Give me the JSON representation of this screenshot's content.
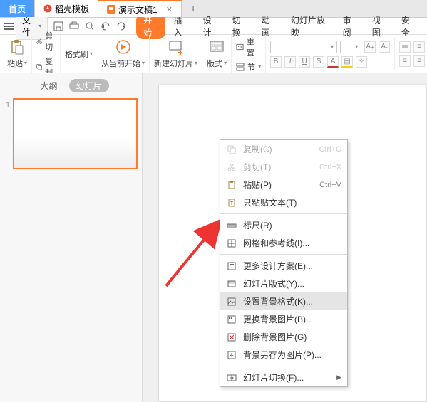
{
  "tabs": {
    "home": "首页",
    "template": "稻壳模板",
    "presentation": "演示文稿1"
  },
  "menubar": {
    "file": "文件",
    "items": [
      "开始",
      "插入",
      "设计",
      "切换",
      "动画",
      "幻灯片放映",
      "审阅",
      "视图",
      "安全"
    ]
  },
  "ribbon": {
    "paste": "粘贴",
    "cut": "剪切",
    "copy": "复制",
    "format_painter": "格式刷",
    "from_begin": "从当前开始",
    "new_slide": "新建幻灯片",
    "layout": "版式",
    "reset": "重置",
    "section": "节",
    "font_name": "",
    "font_size": ""
  },
  "panel": {
    "outline": "大纲",
    "slides": "幻灯片",
    "slide_num": "1"
  },
  "context": {
    "copy": "复制(C)",
    "copy_sc": "Ctrl+C",
    "cut": "剪切(T)",
    "cut_sc": "Ctrl+X",
    "paste": "粘贴(P)",
    "paste_sc": "Ctrl+V",
    "paste_text": "只粘贴文本(T)",
    "ruler": "标尺(R)",
    "grid": "网格和参考线(I)...",
    "more_designs": "更多设计方案(E)...",
    "slide_layout": "幻灯片版式(Y)...",
    "bg_format": "设置背景格式(K)...",
    "change_bg": "更换背景图片(B)...",
    "delete_bg": "删除背景图片(G)",
    "save_bg_as": "背景另存为图片(P)...",
    "slide_transition": "幻灯片切换(F)..."
  }
}
